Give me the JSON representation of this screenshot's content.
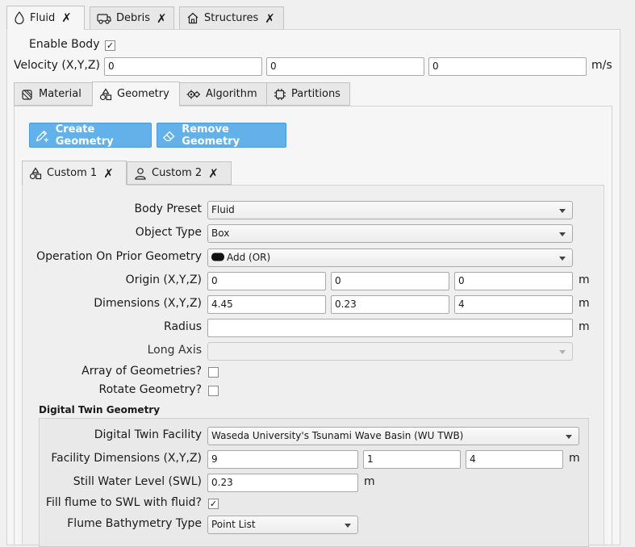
{
  "top_tabs": [
    {
      "label": "Fluid",
      "icon": "droplet-icon"
    },
    {
      "label": "Debris",
      "icon": "vehicle-icon"
    },
    {
      "label": "Structures",
      "icon": "house-icon"
    }
  ],
  "body": {
    "enable_label": "Enable Body",
    "enable_checked": true,
    "velocity_label": "Velocity (X,Y,Z)",
    "velocity": [
      "0",
      "0",
      "0"
    ],
    "velocity_unit": "m/s"
  },
  "sub_tabs": [
    {
      "label": "Material",
      "icon": "material-icon"
    },
    {
      "label": "Geometry",
      "icon": "shapes-icon"
    },
    {
      "label": "Algorithm",
      "icon": "gears-icon"
    },
    {
      "label": "Partitions",
      "icon": "chip-icon"
    }
  ],
  "actions": {
    "create_label": "Create Geometry",
    "remove_label": "Remove Geometry"
  },
  "geom_tabs": [
    {
      "label": "Custom 1",
      "icon": "shapes-icon"
    },
    {
      "label": "Custom 2",
      "icon": "person-icon"
    }
  ],
  "form": {
    "body_preset_label": "Body Preset",
    "body_preset_value": "Fluid",
    "object_type_label": "Object Type",
    "object_type_value": "Box",
    "operation_label": "Operation On Prior Geometry",
    "operation_value": "Add (OR)",
    "origin_label": "Origin (X,Y,Z)",
    "origin": [
      "0",
      "0",
      "0"
    ],
    "origin_unit": "m",
    "dimensions_label": "Dimensions (X,Y,Z)",
    "dimensions": [
      "4.45",
      "0.23",
      "4"
    ],
    "dimensions_unit": "m",
    "radius_label": "Radius",
    "radius_value": "",
    "radius_unit": "m",
    "long_axis_label": "Long Axis",
    "long_axis_value": "",
    "array_label": "Array of Geometries?",
    "array_checked": false,
    "rotate_label": "Rotate Geometry?",
    "rotate_checked": false
  },
  "twin": {
    "section_title": "Digital Twin Geometry",
    "facility_label": "Digital Twin Facility",
    "facility_value": "Waseda University's Tsunami Wave Basin (WU TWB)",
    "facility_dims_label": "Facility Dimensions (X,Y,Z)",
    "facility_dims": [
      "9",
      "1",
      "4"
    ],
    "facility_dims_unit": "m",
    "swl_label": "Still Water Level (SWL)",
    "swl_value": "0.23",
    "swl_unit": "m",
    "fill_label": "Fill flume to SWL with fluid?",
    "fill_checked": true,
    "bathymetry_label": "Flume Bathymetry Type",
    "bathymetry_value": "Point List"
  },
  "check_glyph": "✓",
  "close_glyph": "✗"
}
